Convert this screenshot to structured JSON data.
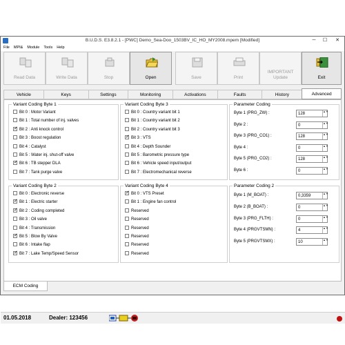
{
  "window": {
    "title": "B.U.D.S. E3.8.2.1 - [PWC] Demo_Sea-Doo_1503BV_IC_HO_MY2008.mpem [Modified]",
    "min": "─",
    "max": "☐",
    "close": "✕"
  },
  "menu": [
    "File",
    "MPI&",
    "Module",
    "Tools",
    "Help"
  ],
  "toolbar": {
    "read": "Read Data",
    "write": "Write Data",
    "stop": "Stop",
    "open": "Open",
    "save": "Save",
    "print": "Print",
    "update1": "IMPORTANT",
    "update2": "Update",
    "exit": "Exit"
  },
  "tabs": [
    "Vehicle",
    "Keys",
    "Settings",
    "Monitoring",
    "Activations",
    "Faults",
    "History",
    "Advanced"
  ],
  "selected_tab": "Advanced",
  "vcb1": {
    "title": "Variant Coding Byte 1",
    "items": [
      {
        "label": "Bit 0 : Motor Variant",
        "checked": false
      },
      {
        "label": "Bit 1 : Total number of inj. valves",
        "checked": false
      },
      {
        "label": "Bit 2 : Anti knock control",
        "checked": true
      },
      {
        "label": "Bit 3 : Boost regulation",
        "checked": false
      },
      {
        "label": "Bit 4 : Catalyst",
        "checked": false
      },
      {
        "label": "Bit 5 : Water inj. shut-off valve",
        "checked": false
      },
      {
        "label": "Bit 6 : TB stepper DLA",
        "checked": true
      },
      {
        "label": "Bit 7 : Tank purge valve",
        "checked": false
      }
    ]
  },
  "vcb3": {
    "title": "Variant Coding Byte 3",
    "items": [
      {
        "label": "Bit 0 : Country variant bit 1",
        "checked": false
      },
      {
        "label": "Bit 1 : Country variant bit 2",
        "checked": false
      },
      {
        "label": "Bit 2 : Country variant bit 3",
        "checked": false
      },
      {
        "label": "Bit 3 : VTS",
        "checked": true
      },
      {
        "label": "Bit 4 : Depth Sounder",
        "checked": false
      },
      {
        "label": "Bit 5 : Barometric pressure type",
        "checked": false
      },
      {
        "label": "Bit 6 : Vehicle speed input/output",
        "checked": false
      },
      {
        "label": "Bit 7 : Electromechanical reverse",
        "checked": false
      }
    ]
  },
  "pc1": {
    "title": "Parameter Coding",
    "items": [
      {
        "label": "Byte 1 (PRG_ZW) :",
        "value": "128"
      },
      {
        "label": "Byte 2 :",
        "value": "0"
      },
      {
        "label": "Byte 3 (PRG_CO1) :",
        "value": "128"
      },
      {
        "label": "Byte 4 :",
        "value": "0"
      },
      {
        "label": "Byte 5 (PRG_CO2) :",
        "value": "128"
      },
      {
        "label": "Byte 6 :",
        "value": "0"
      }
    ]
  },
  "vcb2": {
    "title": "Variant Coding Byte 2",
    "items": [
      {
        "label": "Bit 0 : Electronic reverse",
        "checked": false
      },
      {
        "label": "Bit 1 : Electric starter",
        "checked": true
      },
      {
        "label": "Bit 2 : Coding completed",
        "checked": true
      },
      {
        "label": "Bit 3 : Oil valve",
        "checked": false
      },
      {
        "label": "Bit 4 : Transmission",
        "checked": false
      },
      {
        "label": "Bit 5 : Blow By Valve",
        "checked": true
      },
      {
        "label": "Bit 6 : Intake flap",
        "checked": false
      },
      {
        "label": "Bit 7 : Lake Temp/Speed Sensor",
        "checked": true
      }
    ]
  },
  "vcb4": {
    "title": "Variant Coding Byte 4",
    "items": [
      {
        "label": "Bit 0 : VTS Preset",
        "checked": true
      },
      {
        "label": "Bit 1 : Engine fan control",
        "checked": false
      },
      {
        "label": "Reserved",
        "checked": false
      },
      {
        "label": "Reserved",
        "checked": false
      },
      {
        "label": "Reserved",
        "checked": false
      },
      {
        "label": "Reserved",
        "checked": false
      },
      {
        "label": "Reserved",
        "checked": false
      },
      {
        "label": "Reserved",
        "checked": false
      }
    ]
  },
  "pc2": {
    "title": "Parameter Coding 2",
    "items": [
      {
        "label": "Byte 1 (M_BOAT) :",
        "value": "0,3359"
      },
      {
        "label": "Byte 2 (B_BOAT) :",
        "value": "0"
      },
      {
        "label": "Byte 3 (PRG_FLTH) :",
        "value": "0"
      },
      {
        "label": "Byte 4 (PRGVTSMN) :",
        "value": "4"
      },
      {
        "label": "Byte 5 (PRGVTSMX) :",
        "value": "10"
      }
    ]
  },
  "bottom_tab": "ECM Coding",
  "status": {
    "date": "01.05.2018",
    "dealer": "Dealer: 123456",
    "led_color": "#c01010"
  }
}
